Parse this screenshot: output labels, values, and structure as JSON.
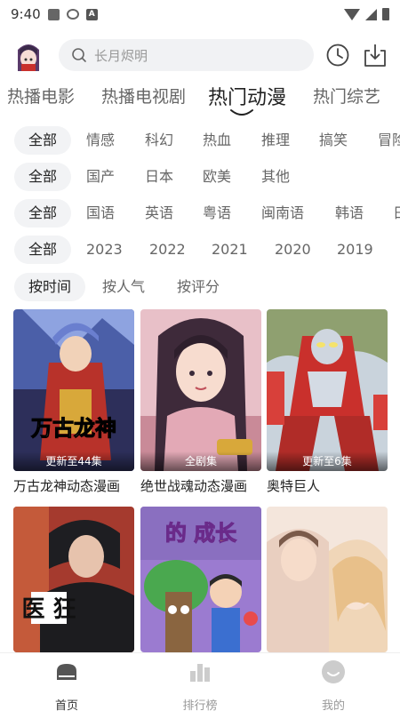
{
  "status_bar": {
    "time": "9:40",
    "app_badge": "A"
  },
  "search": {
    "placeholder": "长月烬明"
  },
  "category_tabs": [
    "热播电影",
    "热播电视剧",
    "热门动漫",
    "热门综艺"
  ],
  "active_tab": "热门动漫",
  "filters": {
    "genre": [
      "全部",
      "情感",
      "科幻",
      "热血",
      "推理",
      "搞笑",
      "冒险"
    ],
    "region": [
      "全部",
      "国产",
      "日本",
      "欧美",
      "其他"
    ],
    "language": [
      "全部",
      "国语",
      "英语",
      "粤语",
      "闽南语",
      "韩语",
      "日"
    ],
    "year": [
      "全部",
      "2023",
      "2022",
      "2021",
      "2020",
      "2019"
    ],
    "sort": [
      "按时间",
      "按人气",
      "按评分"
    ]
  },
  "cards": [
    {
      "title": "万古龙神动态漫画",
      "badge": "更新至44集",
      "poster_text": "万古龙神",
      "colors": [
        "#3a4a8a",
        "#c23a2a"
      ]
    },
    {
      "title": "绝世战魂动态漫画",
      "badge": "全剧集",
      "poster_text": "",
      "colors": [
        "#d7a9b3",
        "#7a5a8a"
      ]
    },
    {
      "title": "奥特巨人",
      "badge": "更新至6集",
      "poster_text": "",
      "colors": [
        "#c9302c",
        "#4a6aa0"
      ]
    },
    {
      "title": "",
      "badge": "",
      "poster_text": "医   狂",
      "colors": [
        "#2b2b2b",
        "#8a3a2a"
      ]
    },
    {
      "title": "",
      "badge": "",
      "poster_text": "的 成长",
      "colors": [
        "#3fa34d",
        "#8e6fbf"
      ]
    },
    {
      "title": "",
      "badge": "",
      "poster_text": "",
      "colors": [
        "#f3e2d6",
        "#e9c9b4"
      ]
    }
  ],
  "bottom_nav": [
    {
      "label": "首页",
      "icon": "home-icon",
      "active": true
    },
    {
      "label": "排行榜",
      "icon": "ranking-icon",
      "active": false
    },
    {
      "label": "我的",
      "icon": "profile-icon",
      "active": false
    }
  ],
  "accent_color": "#333333"
}
